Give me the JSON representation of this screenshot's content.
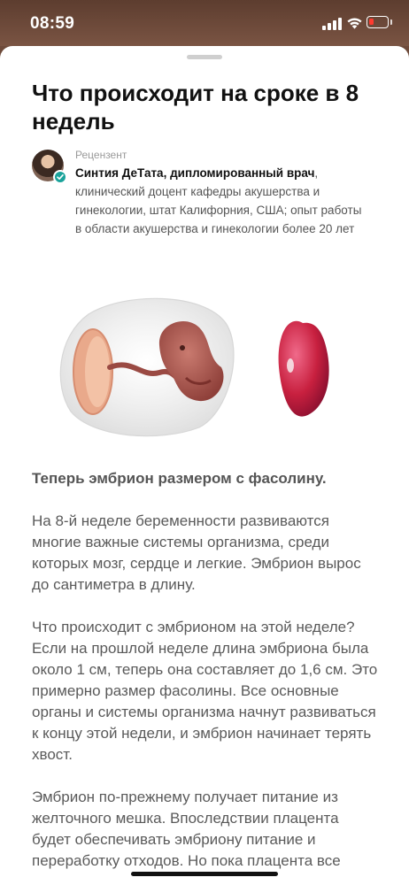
{
  "status_bar": {
    "time": "08:59"
  },
  "article": {
    "title": "Что происходит на сроке в 8 недель",
    "reviewer": {
      "caption": "Рецензент",
      "name": "Синтия ДеТата, дипломированный врач",
      "bio": ", клинический доцент кафедры акушерства и гинекологии, штат Калифорния, США; опыт работы в области акушерства и гинекологии более 20 лет"
    },
    "lead": "Теперь эмбрион размером с фасолину.",
    "paragraphs": [
      "На 8-й неделе беременности развиваются многие важные системы организма, среди которых мозг, сердце и легкие. Эмбрион вырос до сантиметра в длину.",
      "Что происходит с эмбрионом на этой неделе? Если на прошлой неделе длина эмбриона была около 1 см, теперь она составляет до 1,6 см. Это примерно размер фасолины. Все основные органы и системы организма начнут развиваться к концу этой недели, и эмбрион начинает терять хвост.",
      "Эмбрион по-прежнему получает питание из желточного мешка. Впоследствии плацента будет обеспечивать эмбриону питание и переработку отходов. Но пока плацента все"
    ]
  },
  "icons": {
    "signal": "cellular-signal-icon",
    "wifi": "wifi-icon",
    "battery": "battery-low-icon",
    "verified": "verified-check-icon"
  },
  "colors": {
    "accent_verified": "#1aa39b",
    "battery_low": "#ff3b30",
    "embryo": "#a4524a",
    "bean": "#c8203f"
  }
}
